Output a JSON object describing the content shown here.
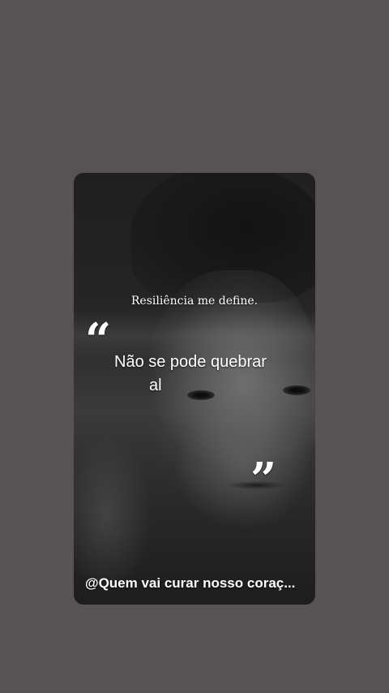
{
  "story": {
    "headline": "Resiliência me define.",
    "quote_open_glyph": "“",
    "quote_line_1": "Não se pode quebrar",
    "quote_line_2": "al",
    "quote_close_glyph": "”",
    "caption": "@Quem vai curar nosso coraç..."
  },
  "colors": {
    "page_background": "#575354",
    "text": "#ffffff"
  }
}
